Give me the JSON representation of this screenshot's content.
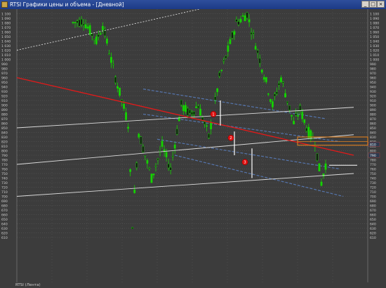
{
  "window": {
    "title": "RTSI Графики цены и объема - [Дневной]",
    "buttons": {
      "minimize": "_",
      "maximize": "□",
      "close": "×"
    }
  },
  "footer": {
    "label": "RTSI (Лента)"
  },
  "colors": {
    "background": "#3c3c3c",
    "grid": "#5e5e5e",
    "candle": "#14d400",
    "candle_down": "#111111",
    "channel": "#dcdcdc",
    "dashed_channel": "#5a7fc0",
    "red_trend": "#e21a1a",
    "orange_box": "#e08020",
    "marker": "#e01010"
  },
  "markers": [
    {
      "label": "1",
      "value": 880
    },
    {
      "label": "2",
      "value": 828
    },
    {
      "label": "3",
      "value": 775
    }
  ],
  "chart_data": {
    "type": "candlestick",
    "ylim": [
      510,
      1110
    ],
    "left_axis": [
      "1 100",
      "1 090",
      "1 080",
      "1 070",
      "1 060",
      "1 050",
      "1 040",
      "1 030",
      "1 020",
      "1 010",
      "1 000",
      "990",
      "980",
      "970",
      "960",
      "950",
      "940",
      "930",
      "920",
      "910",
      "900",
      "890",
      "880",
      "870",
      "860",
      "850",
      "840",
      "830",
      "820",
      "810",
      "800",
      "790",
      "780",
      "770",
      "760",
      "750",
      "740",
      "730",
      "720",
      "710",
      "700",
      "690",
      "680",
      "670",
      "660",
      "650",
      "640",
      "630",
      "620",
      "610"
    ],
    "right_axis": [
      "1 100",
      "1 090",
      "1 080",
      "1 070",
      "1 060",
      "1 050",
      "1 040",
      "1 030",
      "1 020",
      "1 010",
      "1 000",
      "990",
      "980",
      "970",
      "960",
      "950",
      "940",
      "930",
      "920",
      "910",
      "900",
      "890",
      "880",
      "870",
      "860",
      "850",
      "840",
      "830",
      "820",
      "810",
      "800",
      "790",
      "780",
      "770",
      "760",
      "750",
      "740",
      "730",
      "720",
      "710",
      "700",
      "690",
      "680",
      "670",
      "660",
      "650",
      "640",
      "630",
      "620",
      "610"
    ],
    "price_tags": [
      {
        "label": "810",
        "value": 814
      },
      {
        "label": "790",
        "value": 790
      }
    ],
    "series": [
      {
        "segments": [
          {
            "from": 1080,
            "to": 1085,
            "steps": 5
          },
          {
            "from": 1085,
            "to": 1040,
            "steps": 6
          },
          {
            "from": 1040,
            "to": 1075,
            "steps": 3
          },
          {
            "from": 1075,
            "to": 960,
            "steps": 6
          },
          {
            "from": 960,
            "to": 860,
            "steps": 6
          },
          {
            "from": 860,
            "to": 640,
            "steps": 2
          },
          {
            "from": 640,
            "to": 840,
            "steps": 3
          },
          {
            "from": 840,
            "to": 740,
            "steps": 6
          },
          {
            "from": 740,
            "to": 810,
            "steps": 5
          },
          {
            "from": 810,
            "to": 760,
            "steps": 4
          },
          {
            "from": 760,
            "to": 900,
            "steps": 5
          },
          {
            "from": 900,
            "to": 880,
            "steps": 4
          },
          {
            "from": 880,
            "to": 900,
            "steps": 4
          },
          {
            "from": 900,
            "to": 830,
            "steps": 5
          },
          {
            "from": 830,
            "to": 960,
            "steps": 5
          },
          {
            "from": 960,
            "to": 1080,
            "steps": 8
          },
          {
            "from": 1080,
            "to": 1100,
            "steps": 5
          },
          {
            "from": 1100,
            "to": 1000,
            "steps": 6
          },
          {
            "from": 1000,
            "to": 900,
            "steps": 6
          },
          {
            "from": 900,
            "to": 960,
            "steps": 4
          },
          {
            "from": 960,
            "to": 860,
            "steps": 6
          },
          {
            "from": 860,
            "to": 890,
            "steps": 3
          },
          {
            "from": 890,
            "to": 840,
            "steps": 4
          },
          {
            "from": 840,
            "to": 820,
            "steps": 3
          },
          {
            "from": 820,
            "to": 730,
            "steps": 3
          },
          {
            "from": 730,
            "to": 770,
            "steps": 2
          }
        ]
      }
    ],
    "levels": [
      {
        "name": "channel-upper",
        "from": [
          0.0,
          850
        ],
        "to": [
          0.96,
          895
        ],
        "color": "#dcdcdc"
      },
      {
        "name": "channel-middle",
        "from": [
          0.0,
          770
        ],
        "to": [
          0.96,
          835
        ],
        "color": "#dcdcdc"
      },
      {
        "name": "channel-lower",
        "from": [
          0.0,
          700
        ],
        "to": [
          0.96,
          750
        ],
        "color": "#dcdcdc"
      },
      {
        "name": "red-trend",
        "from": [
          0.0,
          960
        ],
        "to": [
          0.96,
          790
        ],
        "color": "#e21a1a"
      },
      {
        "name": "dashed-top",
        "from": [
          0.0,
          1020
        ],
        "to": [
          0.52,
          1110
        ],
        "color": "#dcdcdc",
        "dashed": true
      }
    ]
  }
}
